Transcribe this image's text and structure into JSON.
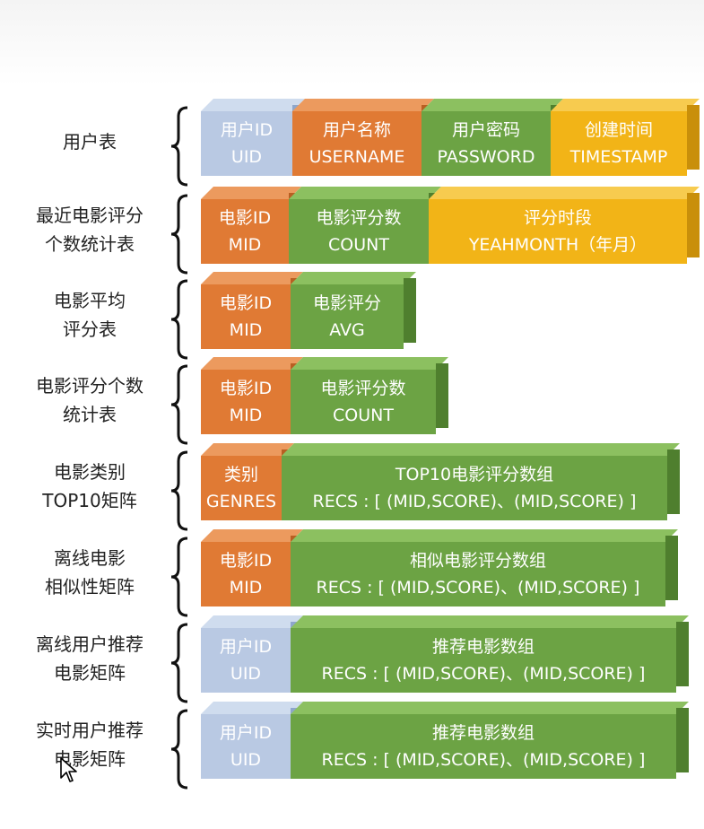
{
  "rows": [
    {
      "label": [
        "用户表"
      ],
      "boxes": [
        {
          "t1": "用户ID",
          "t2": "UID",
          "color": "blue"
        },
        {
          "t1": "用户名称",
          "t2": "USERNAME",
          "color": "orange"
        },
        {
          "t1": "用户密码",
          "t2": "PASSWORD",
          "color": "green"
        },
        {
          "t1": "创建时间",
          "t2": "TIMESTAMP",
          "color": "gold"
        }
      ]
    },
    {
      "label": [
        "最近电影评分",
        "个数统计表"
      ],
      "boxes": [
        {
          "t1": "电影ID",
          "t2": "MID",
          "color": "orange"
        },
        {
          "t1": "电影评分数",
          "t2": "COUNT",
          "color": "green"
        },
        {
          "t1": "评分时段",
          "t2": "YEAHMONTH（年月）",
          "color": "gold"
        }
      ]
    },
    {
      "label": [
        "电影平均",
        "评分表"
      ],
      "boxes": [
        {
          "t1": "电影ID",
          "t2": "MID",
          "color": "orange"
        },
        {
          "t1": "电影评分",
          "t2": "AVG",
          "color": "green"
        }
      ]
    },
    {
      "label": [
        "电影评分个数",
        "统计表"
      ],
      "boxes": [
        {
          "t1": "电影ID",
          "t2": "MID",
          "color": "orange"
        },
        {
          "t1": "电影评分数",
          "t2": "COUNT",
          "color": "green"
        }
      ]
    },
    {
      "label": [
        "电影类别",
        "TOP10矩阵"
      ],
      "boxes": [
        {
          "t1": "类别",
          "t2": "GENRES",
          "color": "orange"
        },
        {
          "t1": "TOP10电影评分数组",
          "t2": "RECS : [ (MID,SCORE)、(MID,SCORE) ]",
          "color": "green"
        }
      ]
    },
    {
      "label": [
        "离线电影",
        "相似性矩阵"
      ],
      "boxes": [
        {
          "t1": "电影ID",
          "t2": "MID",
          "color": "orange"
        },
        {
          "t1": "相似电影评分数组",
          "t2": "RECS : [ (MID,SCORE)、(MID,SCORE) ]",
          "color": "green"
        }
      ]
    },
    {
      "label": [
        "离线用户推荐",
        "电影矩阵"
      ],
      "boxes": [
        {
          "t1": "用户ID",
          "t2": "UID",
          "color": "blue"
        },
        {
          "t1": "推荐电影数组",
          "t2": "RECS : [ (MID,SCORE)、(MID,SCORE) ]",
          "color": "green"
        }
      ]
    },
    {
      "label": [
        "实时用户推荐",
        "电影矩阵"
      ],
      "boxes": [
        {
          "t1": "用户ID",
          "t2": "UID",
          "color": "blue"
        },
        {
          "t1": "推荐电影数组",
          "t2": "RECS : [ (MID,SCORE)、(MID,SCORE) ]",
          "color": "green"
        }
      ]
    }
  ]
}
